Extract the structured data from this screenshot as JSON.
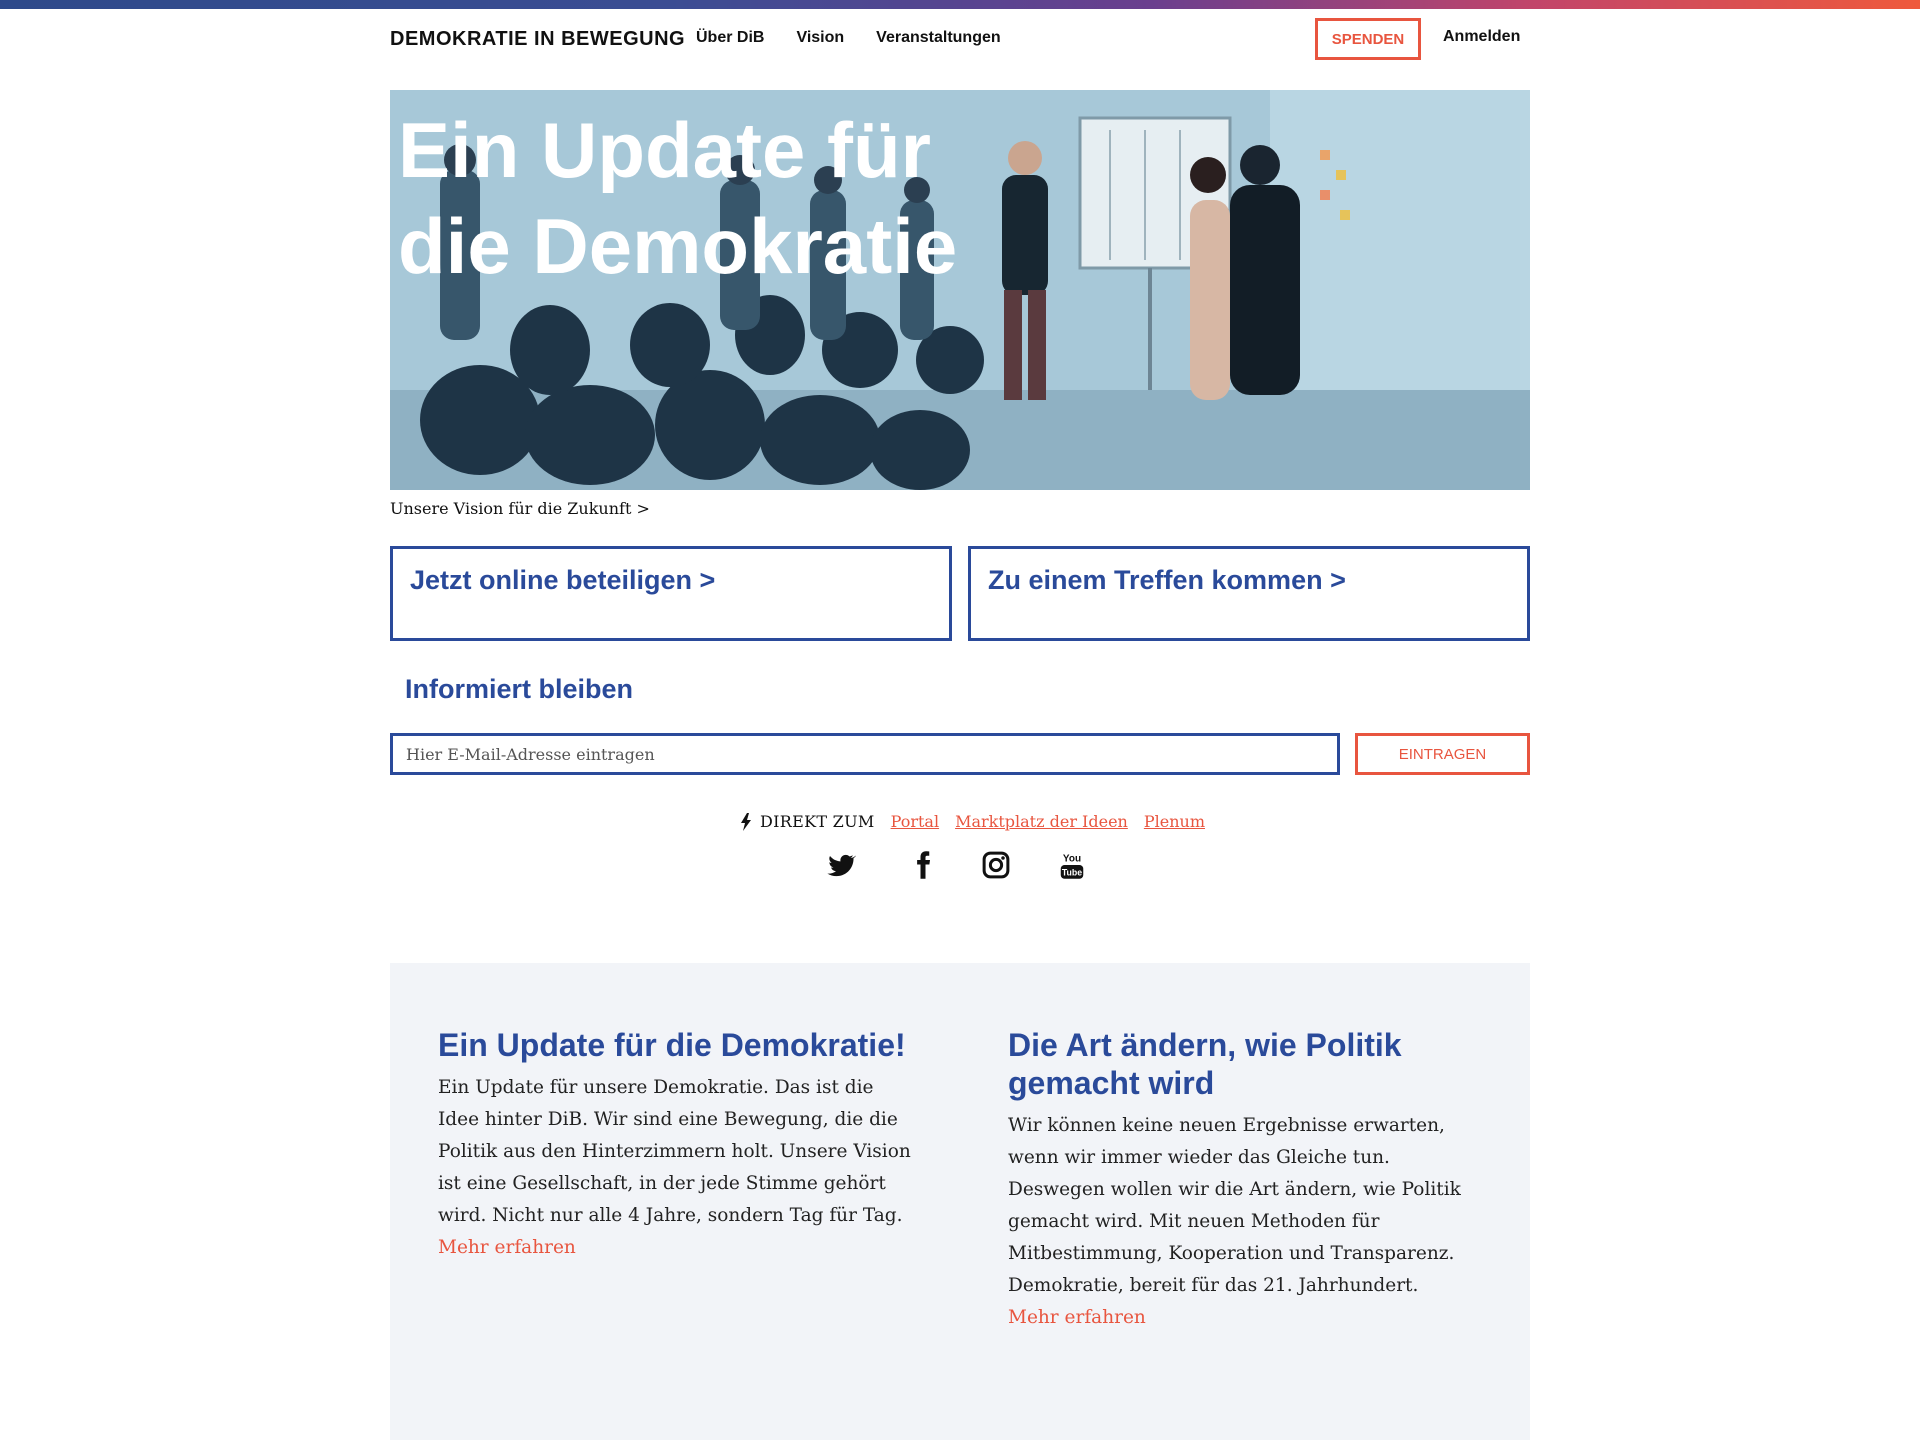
{
  "header": {
    "brand": "DEMOKRATIE IN BEWEGUNG",
    "nav": [
      "Über DiB",
      "Vision",
      "Veranstaltungen"
    ],
    "donate_label": "SPENDEN",
    "login_label": "Anmelden"
  },
  "hero": {
    "title_line1": "Ein Update für",
    "title_line2": "die Demokratie"
  },
  "vision_link": "Unsere Vision für die Zukunft >",
  "cta": {
    "online": "Jetzt online beteiligen >",
    "meeting": "Zu einem Treffen kommen >"
  },
  "newsletter": {
    "heading": "Informiert bleiben",
    "placeholder": "Hier E-Mail-Adresse eintragen",
    "button": "EINTRAGEN"
  },
  "direct": {
    "label": "DIREKT ZUM",
    "links": [
      "Portal",
      "Marktplatz der Ideen",
      "Plenum"
    ]
  },
  "social": [
    "twitter-icon",
    "facebook-icon",
    "instagram-icon",
    "youtube-icon"
  ],
  "info": {
    "col1": {
      "title": "Ein Update für die Demokratie!",
      "text": "Ein Update für unsere Demokratie. Das ist die Idee hinter DiB. Wir sind eine Bewegung, die die Politik aus den Hinterzimmern holt. Unsere Vision ist eine Gesellschaft, in der jede Stimme gehört wird. Nicht nur alle 4 Jahre, sondern Tag für Tag.",
      "more": "Mehr erfahren"
    },
    "col2": {
      "title": "Die Art ändern, wie Politik gemacht wird",
      "text": "Wir können keine neuen Ergebnisse erwarten, wenn wir immer wieder das Gleiche tun. Deswegen wollen wir die Art ändern, wie Politik gemacht wird. Mit neuen Methoden für Mitbestimmung, Kooperation und Transparenz. Demokratie, bereit für das 21. Jahrhundert.",
      "more": "Mehr erfahren"
    }
  },
  "colors": {
    "brand_blue": "#2a4a9a",
    "accent_red": "#e8553f",
    "panel_bg": "#f2f4f8"
  }
}
